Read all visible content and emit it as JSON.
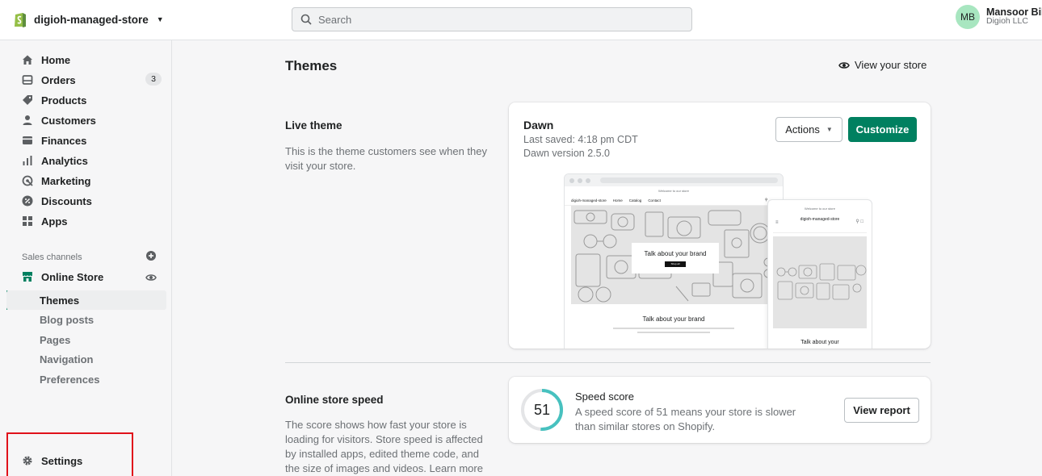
{
  "topbar": {
    "store_name": "digioh-managed-store",
    "search_placeholder": "Search",
    "user_initials": "MB",
    "user_name": "Mansoor Bil",
    "user_org": "Digioh LLC"
  },
  "sidebar": {
    "items": [
      {
        "label": "Home",
        "icon": "home-icon"
      },
      {
        "label": "Orders",
        "icon": "orders-icon",
        "badge": "3"
      },
      {
        "label": "Products",
        "icon": "tag-icon"
      },
      {
        "label": "Customers",
        "icon": "person-icon"
      },
      {
        "label": "Finances",
        "icon": "finances-icon"
      },
      {
        "label": "Analytics",
        "icon": "analytics-icon"
      },
      {
        "label": "Marketing",
        "icon": "marketing-icon"
      },
      {
        "label": "Discounts",
        "icon": "discount-icon"
      },
      {
        "label": "Apps",
        "icon": "apps-icon"
      }
    ],
    "sales_channels_label": "Sales channels",
    "online_store_label": "Online Store",
    "online_store_sub": [
      {
        "label": "Themes",
        "active": true
      },
      {
        "label": "Blog posts"
      },
      {
        "label": "Pages"
      },
      {
        "label": "Navigation"
      },
      {
        "label": "Preferences"
      }
    ],
    "settings_label": "Settings"
  },
  "main": {
    "page_title": "Themes",
    "view_store_label": "View your store",
    "live_theme": {
      "title": "Live theme",
      "description": "This is the theme customers see when they visit your store."
    },
    "theme_card": {
      "name": "Dawn",
      "last_saved": "Last saved: 4:18 pm CDT",
      "version": "Dawn version 2.5.0",
      "actions_label": "Actions",
      "customize_label": "Customize",
      "preview": {
        "announcement": "Welcome to our store",
        "store_name": "digioh-managed-store",
        "nav_links": [
          "Home",
          "Catalog",
          "Contact"
        ],
        "hero_heading": "Talk about your brand",
        "hero_button": "Shop all",
        "section_heading": "Talk about your brand",
        "mobile_store_name": "digioh-managed-store",
        "mobile_heading": "Talk about your"
      }
    },
    "speed": {
      "title": "Online store speed",
      "description": "The score shows how fast your store is loading for visitors. Store speed is affected by installed apps, edited theme code, and the size of images and videos. Learn more about",
      "score": "51",
      "score_fraction": 0.51,
      "score_label": "Speed score",
      "score_description": "A speed score of 51 means your store is slower than similar stores on Shopify.",
      "report_label": "View report"
    }
  },
  "colors": {
    "accent": "#008060",
    "gauge": "#47c1bf",
    "highlight": "#e0111b"
  }
}
